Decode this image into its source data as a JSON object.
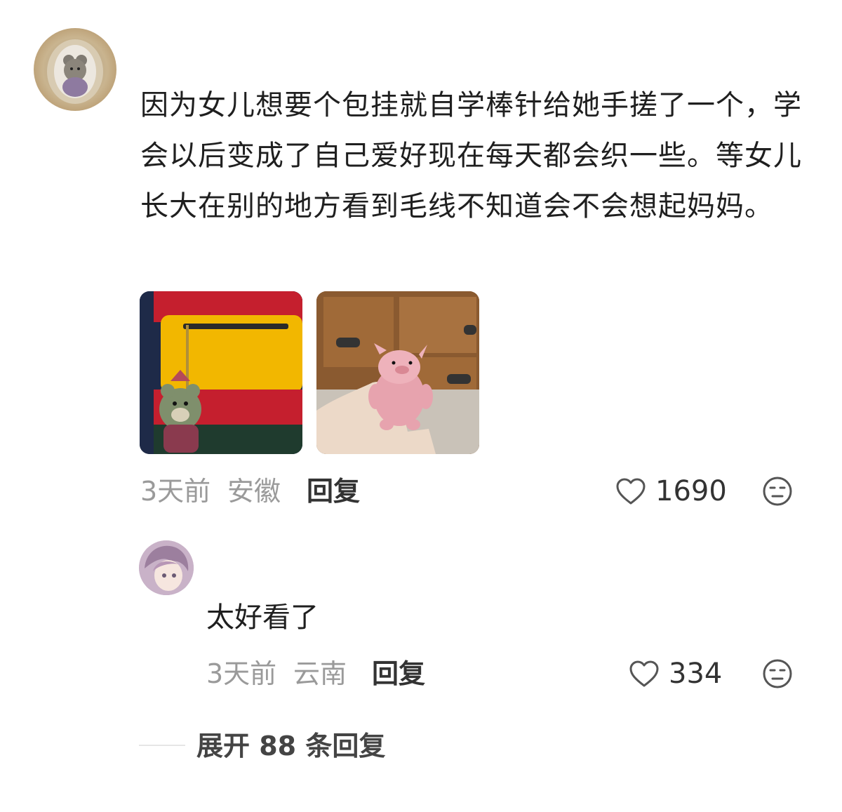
{
  "comment": {
    "text": "因为女儿想要个包挂就自学棒针给她手搓了一个，学会以后变成了自己爱好现在每天都会织一些。等女儿长大在别的地方看到毛线不知道会不会想起妈妈。",
    "time": "3天前",
    "location": "安徽",
    "reply_label": "回复",
    "likes": "1690",
    "avatar_icon": "knitted-bear-avatar",
    "photos": [
      {
        "icon": "knitted-bear-keychain-photo"
      },
      {
        "icon": "knitted-pig-photo"
      }
    ]
  },
  "reply": {
    "text": "太好看了",
    "time": "3天前",
    "location": "云南",
    "reply_label": "回复",
    "likes": "334",
    "avatar_icon": "anime-avatar"
  },
  "expand": {
    "label": "展开 88 条回复"
  },
  "colors": {
    "text": "#1f1f1f",
    "meta": "#9a9a9a",
    "icon": "#555555"
  }
}
